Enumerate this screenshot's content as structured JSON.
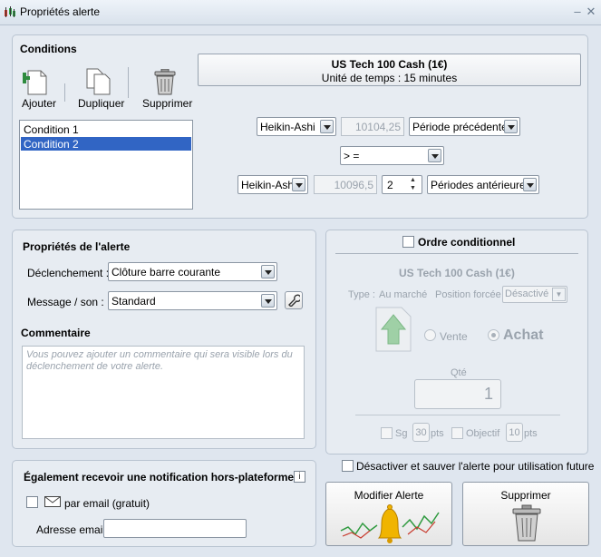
{
  "window": {
    "title": "Propriétés alerte"
  },
  "conditions": {
    "heading": "Conditions",
    "toolbar": {
      "add_label": "Ajouter",
      "duplicate_label": "Dupliquer",
      "delete_label": "Supprimer"
    },
    "list": [
      "Condition 1",
      "Condition 2"
    ],
    "selected_index": 1,
    "instrument": {
      "name": "US Tech 100 Cash (1€)",
      "timeframe": "Unité de temps : 15 minutes"
    },
    "row1": {
      "source": "Heikin-Ashi",
      "value": "10104,25",
      "period": "Période précédente"
    },
    "operator": "> =",
    "row2": {
      "source": "Heikin-Ashi",
      "value": "10096,5",
      "periods_count": "2",
      "period": "Périodes antérieures"
    }
  },
  "alert_props": {
    "heading": "Propriétés de l'alerte",
    "trigger_label": "Déclenchement :",
    "trigger_value": "Clôture barre courante",
    "message_label": "Message / son :",
    "message_value": "Standard",
    "comment_heading": "Commentaire",
    "comment_placeholder": "Vous pouvez ajouter un commentaire qui sera visible lors du déclenchement de votre alerte."
  },
  "notification": {
    "heading": "Également recevoir une notification hors-plateforme",
    "email_label": "par email (gratuit)",
    "address_label": "Adresse email",
    "address_value": ""
  },
  "conditional_order": {
    "checkbox_label": "Ordre conditionnel",
    "instrument": "US Tech 100 Cash (1€)",
    "type_label": "Type :",
    "type_value": "Au marché",
    "position_label": "Position forcée",
    "position_value": "Désactivé",
    "sell_label": "Vente",
    "buy_label": "Achat",
    "qty_label": "Qté",
    "qty_value": "1",
    "sl_label": "Sg",
    "sl_value": "30",
    "sl_unit": "pts",
    "tp_label": "Objectif",
    "tp_value": "10",
    "tp_unit": "pts"
  },
  "footer": {
    "disable_label": "Désactiver et sauver l'alerte pour utilisation future",
    "modify_button": "Modifier Alerte",
    "delete_button": "Supprimer"
  },
  "icons": {
    "app": "candlestick-icon",
    "add": "add-document-icon",
    "duplicate": "copy-documents-icon",
    "delete": "trash-icon",
    "wrench": "wrench-icon",
    "info": "info-icon",
    "mail": "envelope-icon",
    "bell": "bell-icon",
    "arrow_up": "arrow-up-document-icon"
  },
  "colors": {
    "selection": "#3165c4",
    "buy_arrow": "#3aa24c",
    "bell": "#f0b400",
    "window_bg": "#dfe6ef"
  }
}
